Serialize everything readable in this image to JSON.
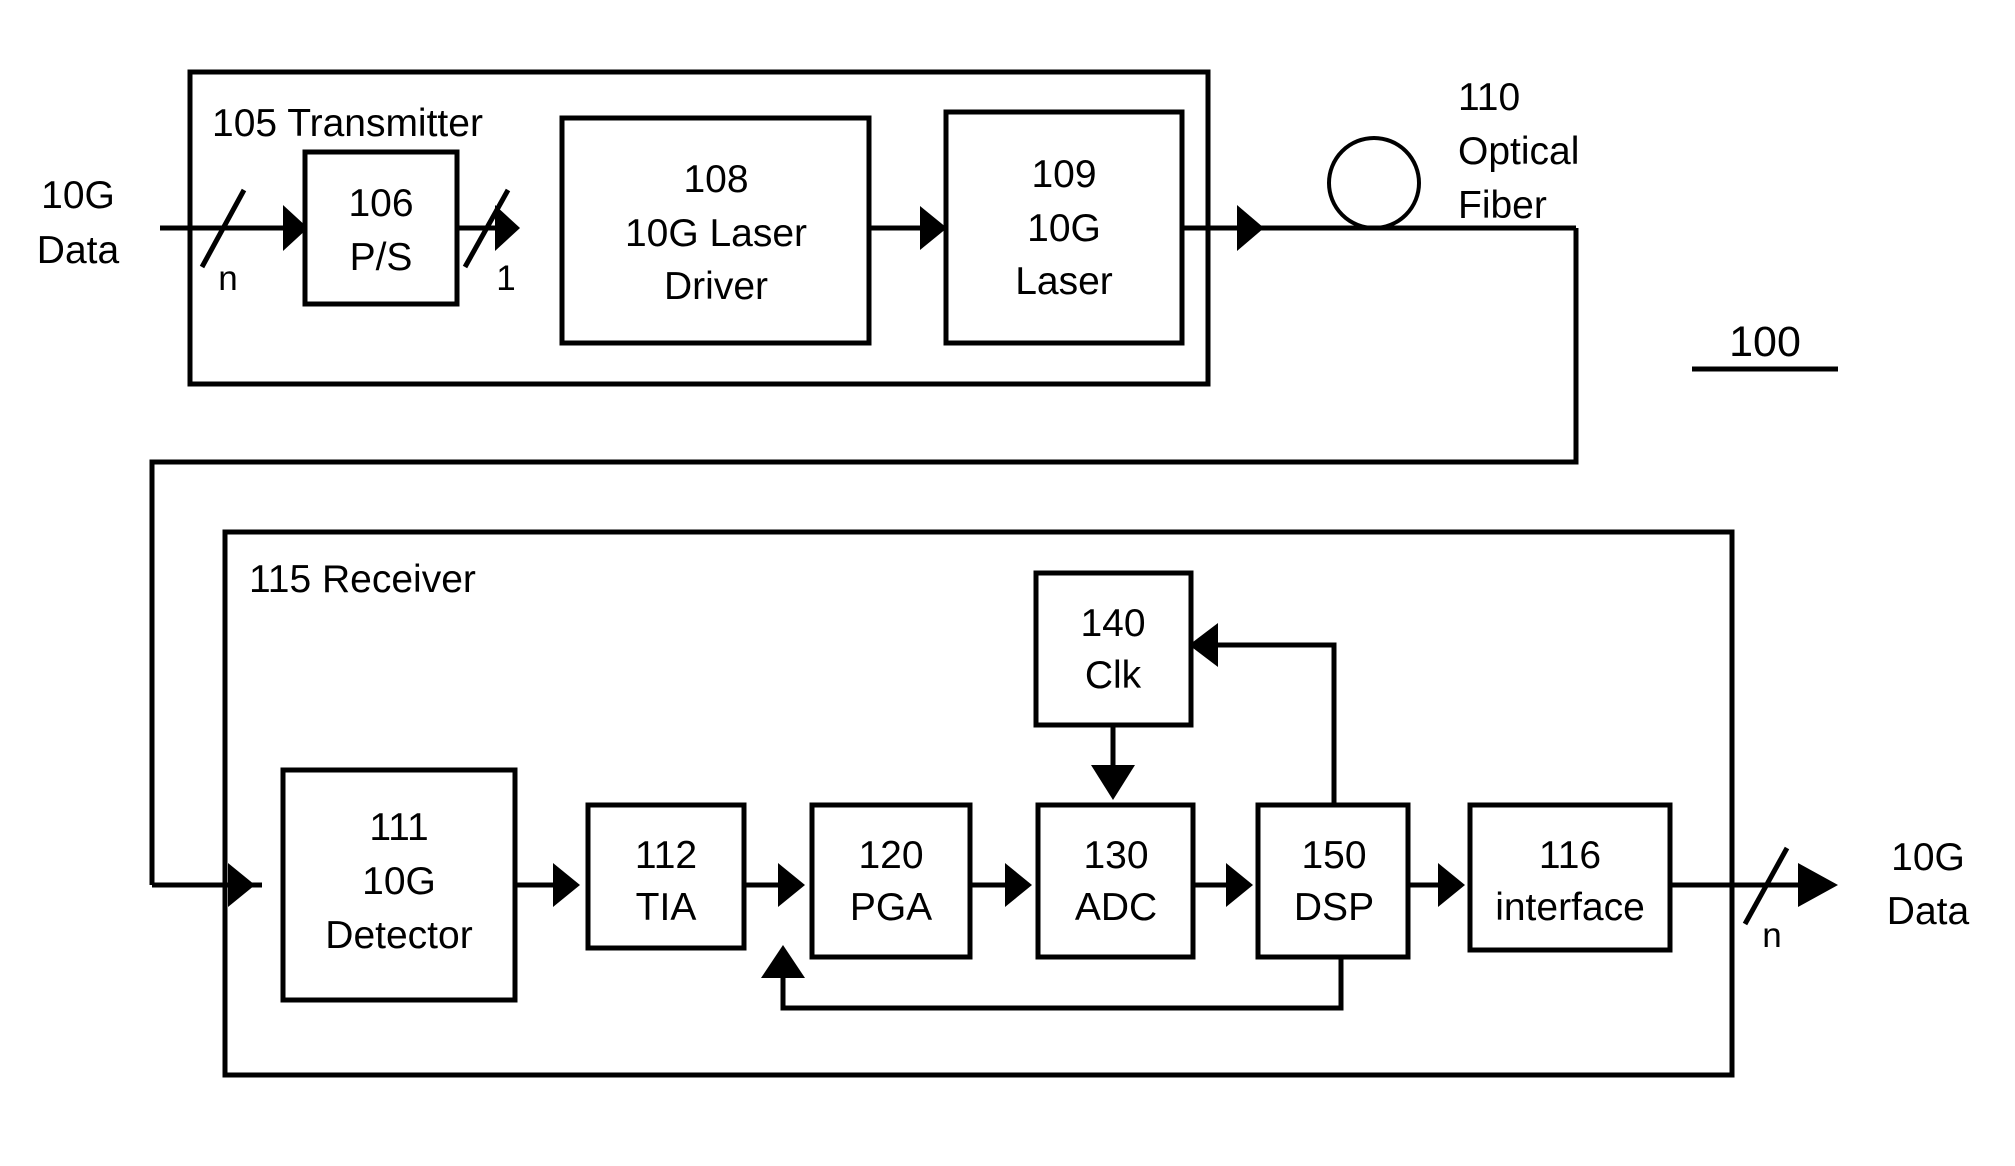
{
  "figure": {
    "reference_numeral": "100",
    "input_signal": {
      "line1": "10G",
      "line2": "Data"
    },
    "output_signal": {
      "line1": "10G",
      "line2": "Data"
    },
    "bus_labels": {
      "tx_input": "n",
      "tx_serial": "1",
      "rx_output": "n"
    }
  },
  "transmitter": {
    "group_label": "105 Transmitter",
    "blocks": [
      {
        "num": "106",
        "line2": "P/S",
        "line3": ""
      },
      {
        "num": "108",
        "line2": "10G Laser",
        "line3": "Driver"
      },
      {
        "num": "109",
        "line2": "10G",
        "line3": "Laser"
      }
    ]
  },
  "fiber": {
    "num": "110",
    "line2": "Optical",
    "line3": "Fiber"
  },
  "receiver": {
    "group_label": "115 Receiver",
    "blocks": [
      {
        "num": "111",
        "line2": "10G",
        "line3": "Detector"
      },
      {
        "num": "112",
        "line2": "TIA",
        "line3": ""
      },
      {
        "num": "120",
        "line2": "PGA",
        "line3": ""
      },
      {
        "num": "130",
        "line2": "ADC",
        "line3": ""
      },
      {
        "num": "150",
        "line2": "DSP",
        "line3": ""
      },
      {
        "num": "116",
        "line2": "interface",
        "line3": ""
      }
    ],
    "clock": {
      "num": "140",
      "line2": "Clk"
    }
  },
  "chart_data": {
    "type": "diagram",
    "title": "10G optical link block diagram",
    "nodes": [
      {
        "id": "106",
        "label": "106 P/S",
        "group": "105 Transmitter"
      },
      {
        "id": "108",
        "label": "108 10G Laser Driver",
        "group": "105 Transmitter"
      },
      {
        "id": "109",
        "label": "109 10G Laser",
        "group": "105 Transmitter"
      },
      {
        "id": "110",
        "label": "110 Optical Fiber",
        "group": ""
      },
      {
        "id": "111",
        "label": "111 10G Detector",
        "group": "115 Receiver"
      },
      {
        "id": "112",
        "label": "112 TIA",
        "group": "115 Receiver"
      },
      {
        "id": "120",
        "label": "120 PGA",
        "group": "115 Receiver"
      },
      {
        "id": "130",
        "label": "130 ADC",
        "group": "115 Receiver"
      },
      {
        "id": "140",
        "label": "140 Clk",
        "group": "115 Receiver"
      },
      {
        "id": "150",
        "label": "150 DSP",
        "group": "115 Receiver"
      },
      {
        "id": "116",
        "label": "116 interface",
        "group": "115 Receiver"
      }
    ],
    "edges": [
      {
        "from": "10G Data in",
        "to": "106",
        "label": "n"
      },
      {
        "from": "106",
        "to": "108",
        "label": "1"
      },
      {
        "from": "108",
        "to": "109",
        "label": ""
      },
      {
        "from": "109",
        "to": "110",
        "label": ""
      },
      {
        "from": "110",
        "to": "111",
        "label": ""
      },
      {
        "from": "111",
        "to": "112",
        "label": ""
      },
      {
        "from": "112",
        "to": "120",
        "label": ""
      },
      {
        "from": "120",
        "to": "130",
        "label": ""
      },
      {
        "from": "130",
        "to": "150",
        "label": ""
      },
      {
        "from": "140",
        "to": "130",
        "label": ""
      },
      {
        "from": "150",
        "to": "140",
        "label": ""
      },
      {
        "from": "150",
        "to": "120",
        "label": ""
      },
      {
        "from": "150",
        "to": "116",
        "label": ""
      },
      {
        "from": "116",
        "to": "10G Data out",
        "label": "n"
      }
    ]
  }
}
